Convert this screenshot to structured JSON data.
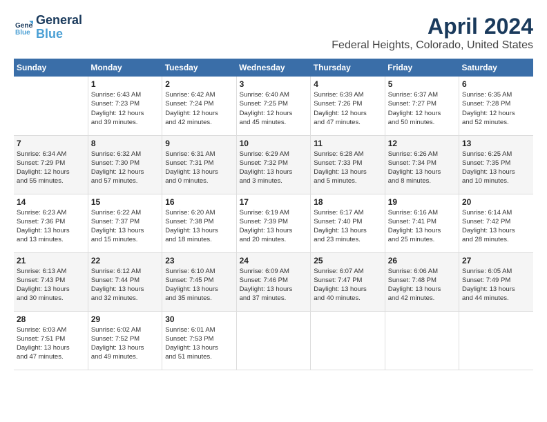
{
  "header": {
    "logo_line1": "General",
    "logo_line2": "Blue",
    "month_title": "April 2024",
    "location": "Federal Heights, Colorado, United States"
  },
  "days_of_week": [
    "Sunday",
    "Monday",
    "Tuesday",
    "Wednesday",
    "Thursday",
    "Friday",
    "Saturday"
  ],
  "weeks": [
    [
      {
        "num": "",
        "info": ""
      },
      {
        "num": "1",
        "info": "Sunrise: 6:43 AM\nSunset: 7:23 PM\nDaylight: 12 hours\nand 39 minutes."
      },
      {
        "num": "2",
        "info": "Sunrise: 6:42 AM\nSunset: 7:24 PM\nDaylight: 12 hours\nand 42 minutes."
      },
      {
        "num": "3",
        "info": "Sunrise: 6:40 AM\nSunset: 7:25 PM\nDaylight: 12 hours\nand 45 minutes."
      },
      {
        "num": "4",
        "info": "Sunrise: 6:39 AM\nSunset: 7:26 PM\nDaylight: 12 hours\nand 47 minutes."
      },
      {
        "num": "5",
        "info": "Sunrise: 6:37 AM\nSunset: 7:27 PM\nDaylight: 12 hours\nand 50 minutes."
      },
      {
        "num": "6",
        "info": "Sunrise: 6:35 AM\nSunset: 7:28 PM\nDaylight: 12 hours\nand 52 minutes."
      }
    ],
    [
      {
        "num": "7",
        "info": "Sunrise: 6:34 AM\nSunset: 7:29 PM\nDaylight: 12 hours\nand 55 minutes."
      },
      {
        "num": "8",
        "info": "Sunrise: 6:32 AM\nSunset: 7:30 PM\nDaylight: 12 hours\nand 57 minutes."
      },
      {
        "num": "9",
        "info": "Sunrise: 6:31 AM\nSunset: 7:31 PM\nDaylight: 13 hours\nand 0 minutes."
      },
      {
        "num": "10",
        "info": "Sunrise: 6:29 AM\nSunset: 7:32 PM\nDaylight: 13 hours\nand 3 minutes."
      },
      {
        "num": "11",
        "info": "Sunrise: 6:28 AM\nSunset: 7:33 PM\nDaylight: 13 hours\nand 5 minutes."
      },
      {
        "num": "12",
        "info": "Sunrise: 6:26 AM\nSunset: 7:34 PM\nDaylight: 13 hours\nand 8 minutes."
      },
      {
        "num": "13",
        "info": "Sunrise: 6:25 AM\nSunset: 7:35 PM\nDaylight: 13 hours\nand 10 minutes."
      }
    ],
    [
      {
        "num": "14",
        "info": "Sunrise: 6:23 AM\nSunset: 7:36 PM\nDaylight: 13 hours\nand 13 minutes."
      },
      {
        "num": "15",
        "info": "Sunrise: 6:22 AM\nSunset: 7:37 PM\nDaylight: 13 hours\nand 15 minutes."
      },
      {
        "num": "16",
        "info": "Sunrise: 6:20 AM\nSunset: 7:38 PM\nDaylight: 13 hours\nand 18 minutes."
      },
      {
        "num": "17",
        "info": "Sunrise: 6:19 AM\nSunset: 7:39 PM\nDaylight: 13 hours\nand 20 minutes."
      },
      {
        "num": "18",
        "info": "Sunrise: 6:17 AM\nSunset: 7:40 PM\nDaylight: 13 hours\nand 23 minutes."
      },
      {
        "num": "19",
        "info": "Sunrise: 6:16 AM\nSunset: 7:41 PM\nDaylight: 13 hours\nand 25 minutes."
      },
      {
        "num": "20",
        "info": "Sunrise: 6:14 AM\nSunset: 7:42 PM\nDaylight: 13 hours\nand 28 minutes."
      }
    ],
    [
      {
        "num": "21",
        "info": "Sunrise: 6:13 AM\nSunset: 7:43 PM\nDaylight: 13 hours\nand 30 minutes."
      },
      {
        "num": "22",
        "info": "Sunrise: 6:12 AM\nSunset: 7:44 PM\nDaylight: 13 hours\nand 32 minutes."
      },
      {
        "num": "23",
        "info": "Sunrise: 6:10 AM\nSunset: 7:45 PM\nDaylight: 13 hours\nand 35 minutes."
      },
      {
        "num": "24",
        "info": "Sunrise: 6:09 AM\nSunset: 7:46 PM\nDaylight: 13 hours\nand 37 minutes."
      },
      {
        "num": "25",
        "info": "Sunrise: 6:07 AM\nSunset: 7:47 PM\nDaylight: 13 hours\nand 40 minutes."
      },
      {
        "num": "26",
        "info": "Sunrise: 6:06 AM\nSunset: 7:48 PM\nDaylight: 13 hours\nand 42 minutes."
      },
      {
        "num": "27",
        "info": "Sunrise: 6:05 AM\nSunset: 7:49 PM\nDaylight: 13 hours\nand 44 minutes."
      }
    ],
    [
      {
        "num": "28",
        "info": "Sunrise: 6:03 AM\nSunset: 7:51 PM\nDaylight: 13 hours\nand 47 minutes."
      },
      {
        "num": "29",
        "info": "Sunrise: 6:02 AM\nSunset: 7:52 PM\nDaylight: 13 hours\nand 49 minutes."
      },
      {
        "num": "30",
        "info": "Sunrise: 6:01 AM\nSunset: 7:53 PM\nDaylight: 13 hours\nand 51 minutes."
      },
      {
        "num": "",
        "info": ""
      },
      {
        "num": "",
        "info": ""
      },
      {
        "num": "",
        "info": ""
      },
      {
        "num": "",
        "info": ""
      }
    ]
  ]
}
